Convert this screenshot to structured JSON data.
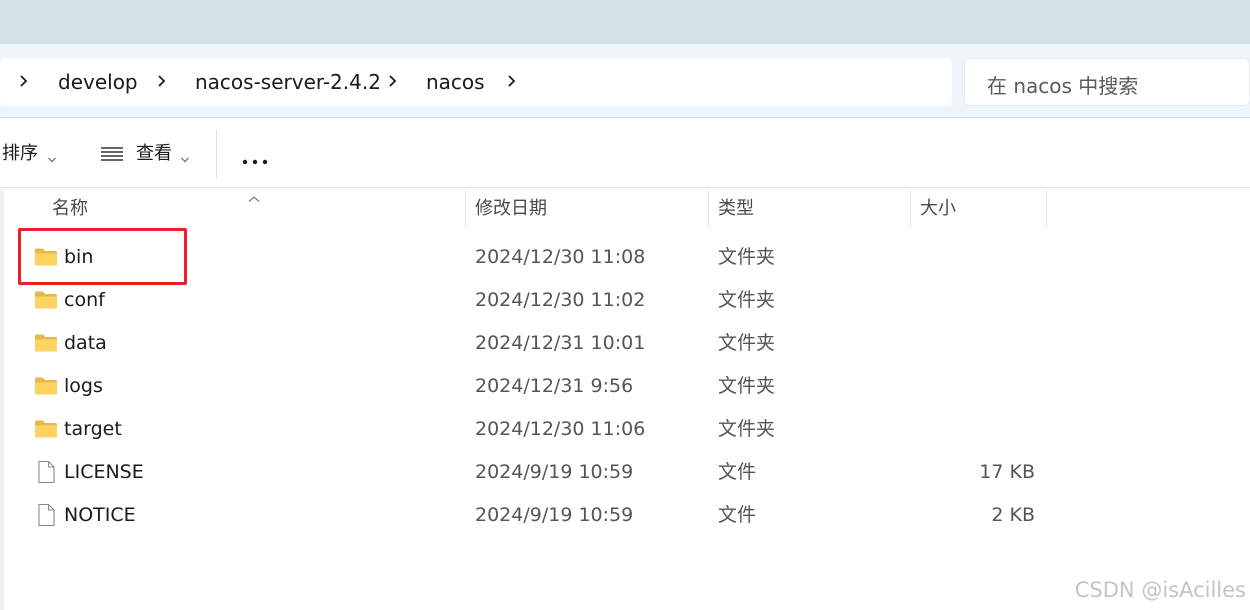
{
  "address_bar": {
    "breadcrumbs": [
      "develop",
      "nacos-server-2.4.2",
      "nacos"
    ],
    "search_placeholder": "在 nacos 中搜索"
  },
  "toolbar": {
    "sort_label": "排序",
    "view_label": "查看",
    "more_icon": "more-icon"
  },
  "columns": {
    "name": "名称",
    "modified": "修改日期",
    "type": "类型",
    "size": "大小"
  },
  "files": [
    {
      "name": "bin",
      "date": "2024/12/30 11:08",
      "type": "文件夹",
      "size": "",
      "icon": "folder-icon"
    },
    {
      "name": "conf",
      "date": "2024/12/30 11:02",
      "type": "文件夹",
      "size": "",
      "icon": "folder-icon"
    },
    {
      "name": "data",
      "date": "2024/12/31 10:01",
      "type": "文件夹",
      "size": "",
      "icon": "folder-icon"
    },
    {
      "name": "logs",
      "date": "2024/12/31 9:56",
      "type": "文件夹",
      "size": "",
      "icon": "folder-icon"
    },
    {
      "name": "target",
      "date": "2024/12/30 11:06",
      "type": "文件夹",
      "size": "",
      "icon": "folder-icon"
    },
    {
      "name": "LICENSE",
      "date": "2024/9/19 10:59",
      "type": "文件",
      "size": "17 KB",
      "icon": "file-icon"
    },
    {
      "name": "NOTICE",
      "date": "2024/9/19 10:59",
      "type": "文件",
      "size": "2 KB",
      "icon": "file-icon"
    }
  ],
  "annotation": {
    "highlight_color": "#e8202a"
  },
  "watermark": "CSDN @isAcilles"
}
